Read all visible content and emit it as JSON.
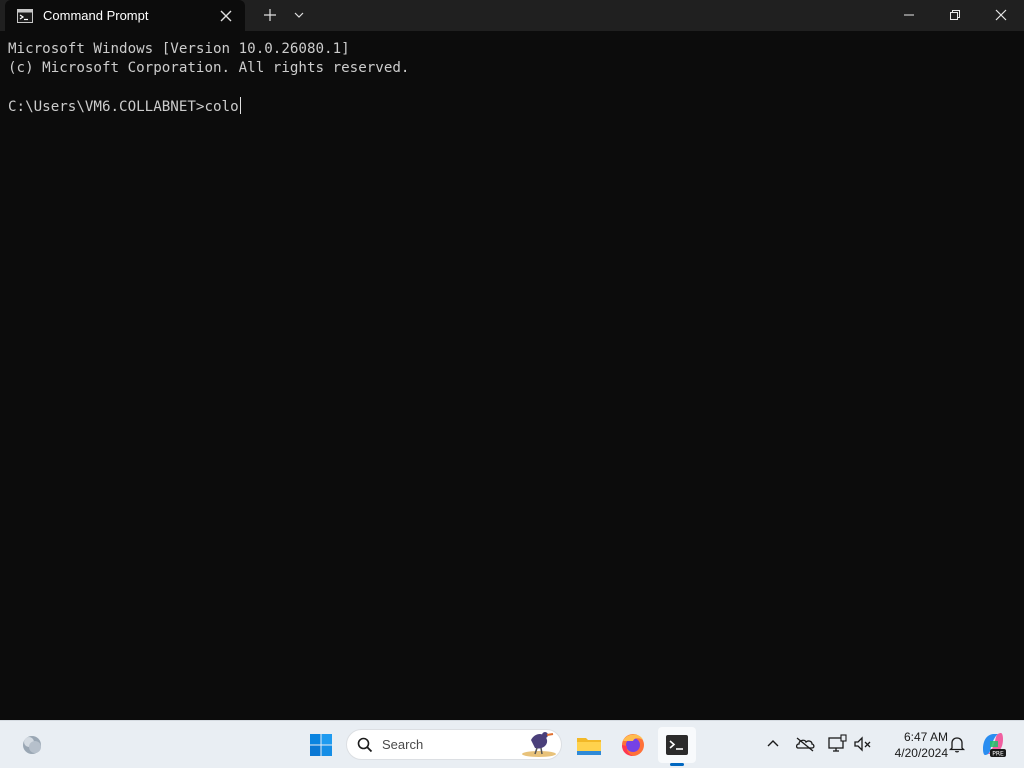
{
  "window": {
    "tab_title": "Command Prompt",
    "tab_icon": "cmd-icon",
    "buttons": {
      "new_tab": "plus-icon",
      "tab_menu": "chevron-down-icon",
      "minimize": "minimize-icon",
      "maximize": "restore-icon",
      "close": "close-icon"
    }
  },
  "terminal": {
    "lines": [
      "Microsoft Windows [Version 10.0.26080.1]",
      "(c) Microsoft Corporation. All rights reserved.",
      ""
    ],
    "prompt": "C:\\Users\\VM6.COLLABNET>",
    "input": "colo",
    "text_color": "#cccccc",
    "background": "#0c0c0c"
  },
  "taskbar": {
    "search_placeholder": "Search",
    "apps": [
      "start-icon",
      "file-explorer-icon",
      "firefox-icon",
      "terminal-icon"
    ],
    "active_app": "terminal-icon",
    "tray": {
      "time": "6:47 AM",
      "date": "4/20/2024",
      "icons": [
        "chevron-up-icon",
        "onedrive-icon",
        "network-icon",
        "volume-icon",
        "bell-icon",
        "copilot-icon"
      ]
    },
    "accent": "#0067c0"
  }
}
